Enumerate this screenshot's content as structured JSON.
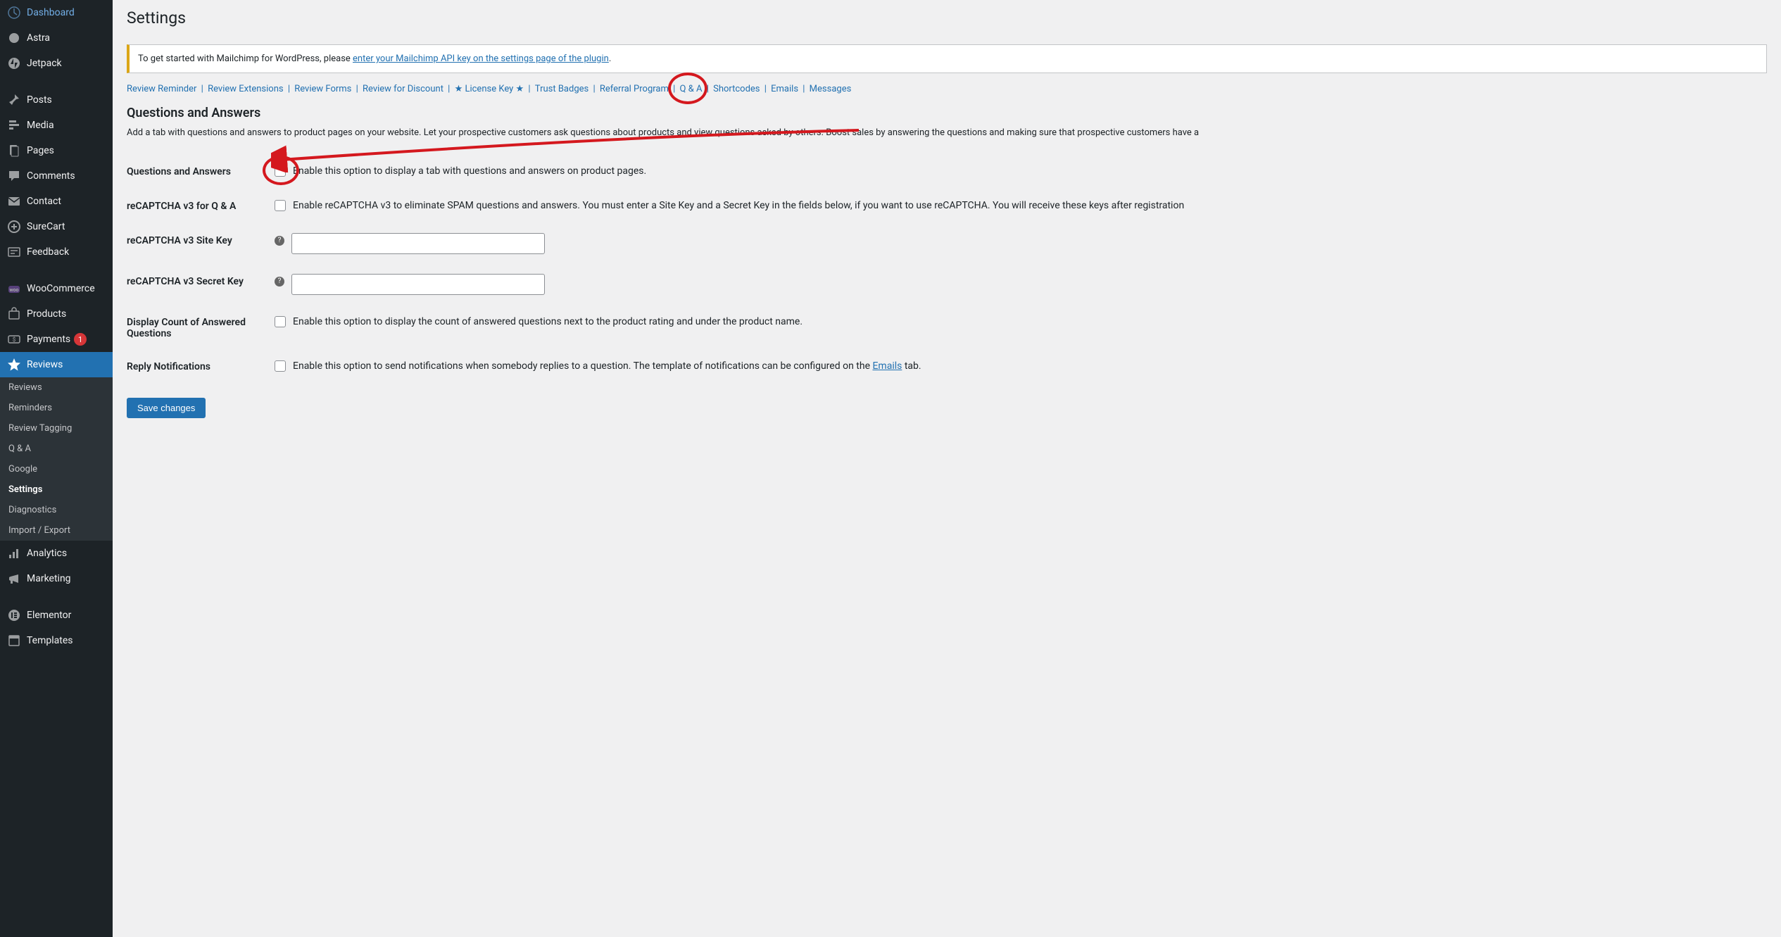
{
  "sidebar": {
    "items": [
      {
        "label": "Dashboard",
        "icon": "dashboard"
      },
      {
        "label": "Astra",
        "icon": "astra"
      },
      {
        "label": "Jetpack",
        "icon": "jetpack"
      }
    ],
    "items2": [
      {
        "label": "Posts",
        "icon": "pin"
      },
      {
        "label": "Media",
        "icon": "media"
      },
      {
        "label": "Pages",
        "icon": "pages"
      },
      {
        "label": "Comments",
        "icon": "comments"
      },
      {
        "label": "Contact",
        "icon": "contact"
      },
      {
        "label": "SureCart",
        "icon": "surecart"
      },
      {
        "label": "Feedback",
        "icon": "feedback"
      }
    ],
    "items3": [
      {
        "label": "WooCommerce",
        "icon": "woo"
      },
      {
        "label": "Products",
        "icon": "products"
      },
      {
        "label": "Payments",
        "icon": "payments",
        "badge": "1"
      },
      {
        "label": "Reviews",
        "icon": "star",
        "active": true
      }
    ],
    "submenu": [
      {
        "label": "Reviews"
      },
      {
        "label": "Reminders"
      },
      {
        "label": "Review Tagging"
      },
      {
        "label": "Q & A"
      },
      {
        "label": "Google"
      },
      {
        "label": "Settings",
        "current": true
      },
      {
        "label": "Diagnostics"
      },
      {
        "label": "Import / Export"
      }
    ],
    "items4": [
      {
        "label": "Analytics",
        "icon": "analytics"
      },
      {
        "label": "Marketing",
        "icon": "marketing"
      }
    ],
    "items5": [
      {
        "label": "Elementor",
        "icon": "elementor"
      },
      {
        "label": "Templates",
        "icon": "templates"
      }
    ]
  },
  "main": {
    "page_title": "Settings",
    "notice_prefix": "To get started with Mailchimp for WordPress, please ",
    "notice_link": "enter your Mailchimp API key on the settings page of the plugin",
    "notice_suffix": ".",
    "tabs": [
      "Review Reminder",
      "Review Extensions",
      "Review Forms",
      "Review for Discount",
      "★ License Key ★",
      "Trust Badges",
      "Referral Program",
      "Q & A",
      "Shortcodes",
      "Emails",
      "Messages"
    ],
    "section_title": "Questions and Answers",
    "section_desc": "Add a tab with questions and answers to product pages on your website. Let your prospective customers ask questions about products and view questions asked by others. Boost sales by answering the questions and making sure that prospective customers have a",
    "rows": {
      "qna": {
        "label": "Questions and Answers",
        "desc": "Enable this option to display a tab with questions and answers on product pages."
      },
      "recaptcha_enable": {
        "label": "reCAPTCHA v3 for Q & A",
        "desc": "Enable reCAPTCHA v3 to eliminate SPAM questions and answers. You must enter a Site Key and a Secret Key in the fields below, if you want to use reCAPTCHA. You will receive these keys after registration"
      },
      "site_key": {
        "label": "reCAPTCHA v3 Site Key"
      },
      "secret_key": {
        "label": "reCAPTCHA v3 Secret Key"
      },
      "display_count": {
        "label": "Display Count of Answered Questions",
        "desc": "Enable this option to display the count of answered questions next to the product rating and under the product name."
      },
      "reply_notif": {
        "label": "Reply Notifications",
        "desc_pre": "Enable this option to send notifications when somebody replies to a question. The template of notifications can be configured on the ",
        "desc_link": "Emails",
        "desc_post": " tab."
      }
    },
    "save_label": "Save changes"
  }
}
